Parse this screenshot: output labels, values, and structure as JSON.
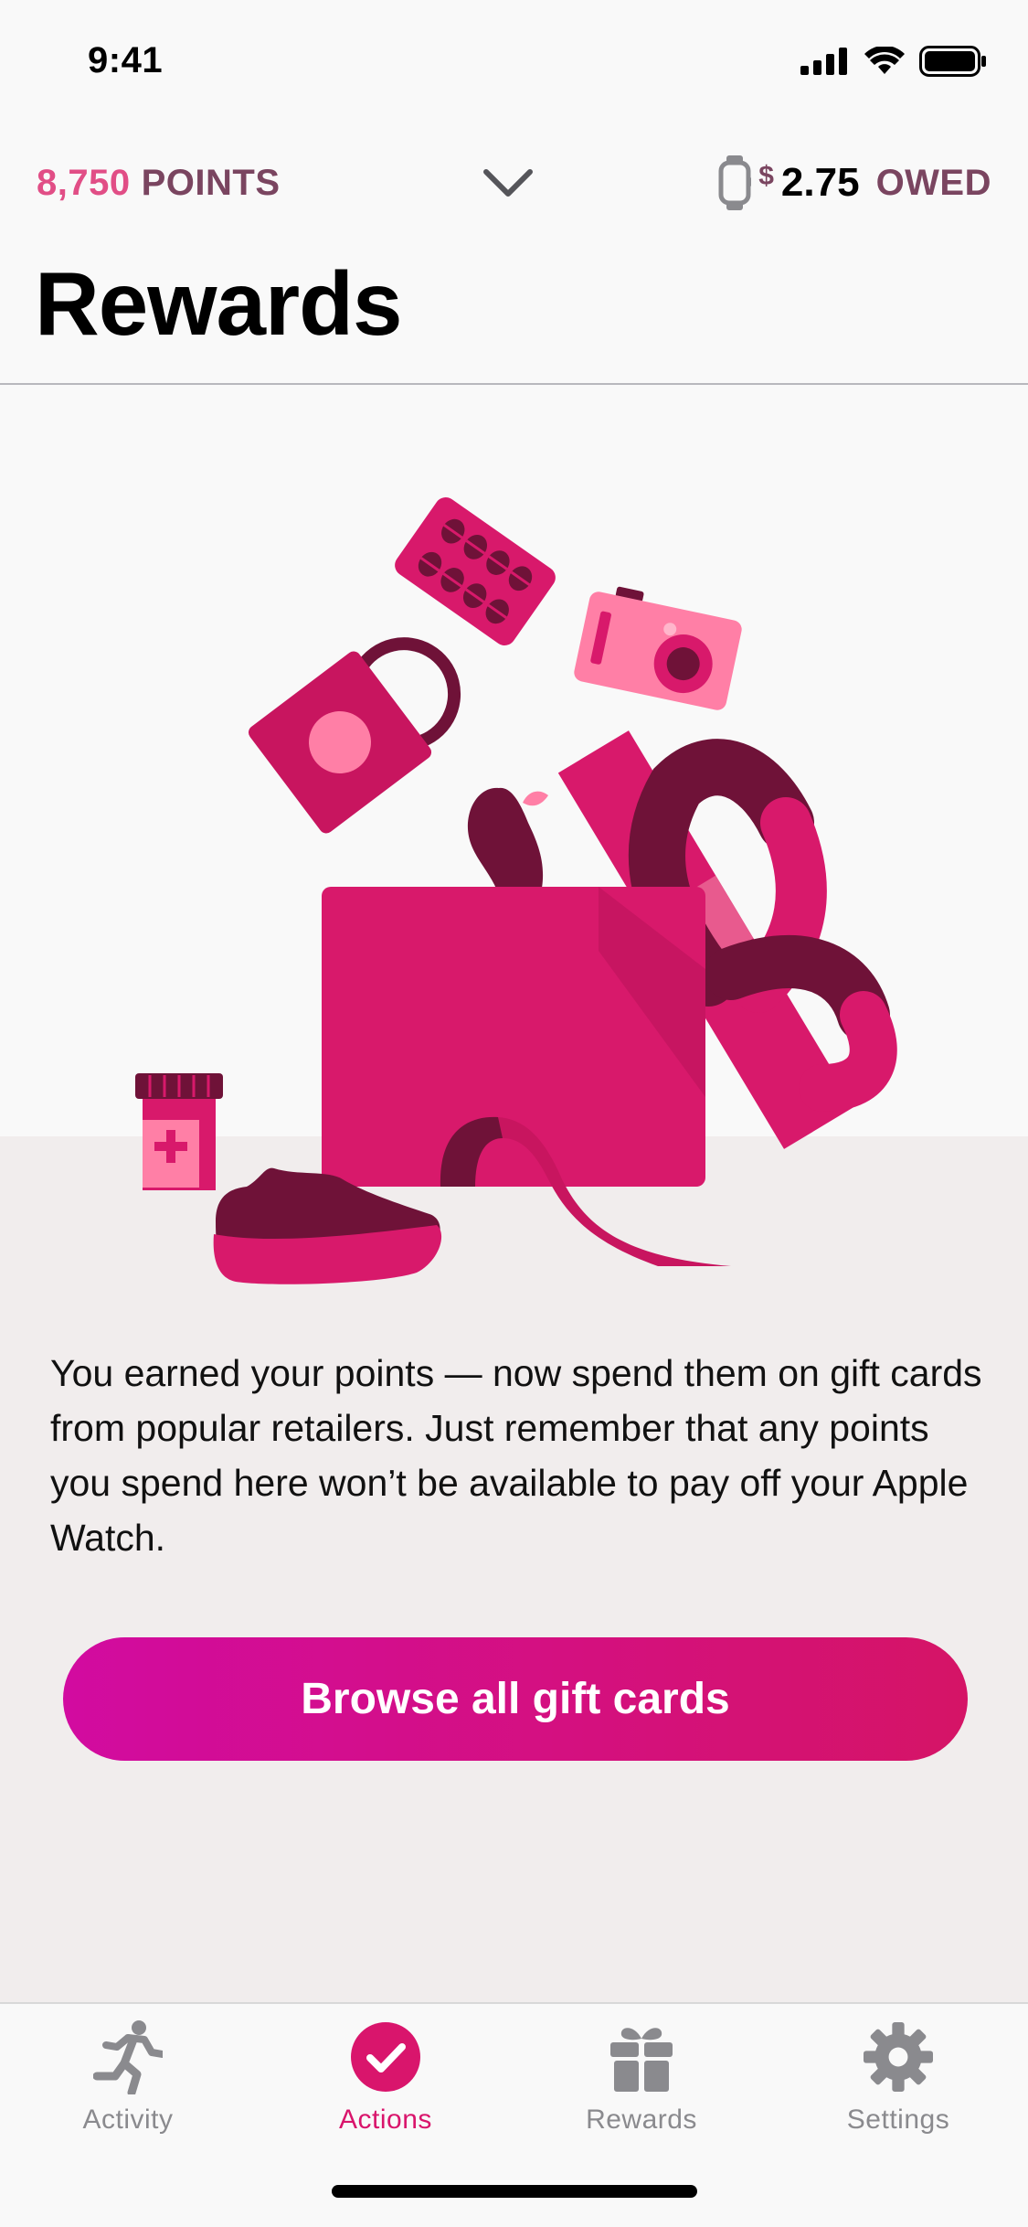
{
  "status_bar": {
    "time": "9:41"
  },
  "header": {
    "points_value": "8,750",
    "points_label": "POINTS",
    "owed_currency": "$",
    "owed_amount": "2.75",
    "owed_label": "OWED"
  },
  "page": {
    "title": "Rewards",
    "description": "You earned your points — now spend them on gift cards from popular retailers. Just remember that any points you spend here won’t be available to pay off your Apple Watch.",
    "cta_label": "Browse all gift cards"
  },
  "tabs": [
    {
      "label": "Activity",
      "icon": "running-person-icon",
      "active": false
    },
    {
      "label": "Actions",
      "icon": "checkmark-circle-icon",
      "active": true
    },
    {
      "label": "Rewards",
      "icon": "gift-icon",
      "active": false
    },
    {
      "label": "Settings",
      "icon": "gear-icon",
      "active": false
    }
  ],
  "colors": {
    "accent_pink": "#d9156c",
    "points_pink": "#e14e86",
    "label_plum": "#7a4560",
    "button_gradient_start": "#d20ba0",
    "button_gradient_end": "#d51466",
    "inactive_tab": "#8a8a8e"
  }
}
